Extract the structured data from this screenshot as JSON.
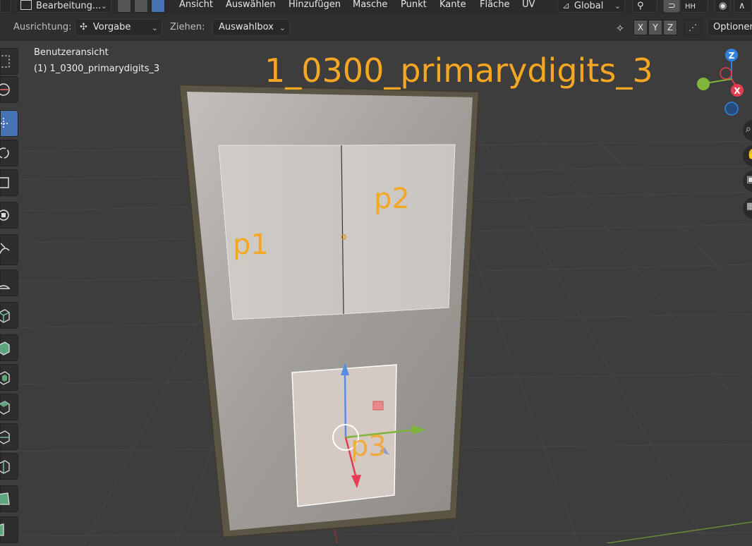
{
  "header": {
    "mode_dropdown": "Bearbeitung...",
    "menus": [
      "Ansicht",
      "Auswählen",
      "Hinzufügen",
      "Masche",
      "Punkt",
      "Kante",
      "Fläche",
      "UV"
    ],
    "transform_orientation": "Global"
  },
  "tool_header": {
    "orientation_label": "Ausrichtung:",
    "orientation_value": "Vorgabe",
    "drag_label": "Ziehen:",
    "drag_value": "Auswahlbox",
    "axis_x": "X",
    "axis_y": "Y",
    "axis_z": "Z",
    "options_label": "Optionen"
  },
  "viewport": {
    "view_name": "Benutzeransicht",
    "object_info": "(1) 1_0300_primarydigits_3",
    "overlay_title": "1_0300_primarydigits_3",
    "face_labels": [
      "p1",
      "p2",
      "p3"
    ],
    "gizmo_axes": {
      "z": "Z",
      "x": "X"
    }
  },
  "colors": {
    "accent": "#4772b3",
    "label_orange": "#f5a623",
    "axis_x": "#e63c52",
    "axis_y": "#7fb53a",
    "axis_z": "#2f83e0"
  }
}
